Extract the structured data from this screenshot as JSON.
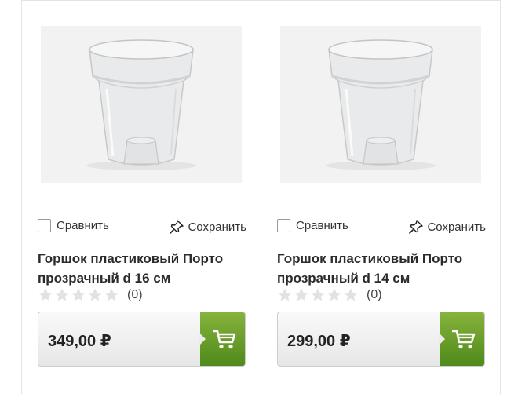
{
  "products": [
    {
      "image_icon": "clear-plastic-pot-image",
      "compare_label": "Сравнить",
      "save_label": "Сохранить",
      "title": "Горшок пластиковый Порто прозрачный d 16 см",
      "rating_stars": 0,
      "rating_count": "(0)",
      "price": "349,00 ₽",
      "cart_icon": "cart-icon"
    },
    {
      "image_icon": "clear-plastic-pot-image",
      "compare_label": "Сравнить",
      "save_label": "Сохранить",
      "title": "Горшок пластиковый Порто прозрачный d 14 см",
      "rating_stars": 0,
      "rating_count": "(0)",
      "price": "299,00 ₽",
      "cart_icon": "cart-icon"
    }
  ],
  "colors": {
    "cart_button": "#6a9f2a",
    "star_empty": "#e2e2e2",
    "card_border": "#e3e3e3"
  }
}
